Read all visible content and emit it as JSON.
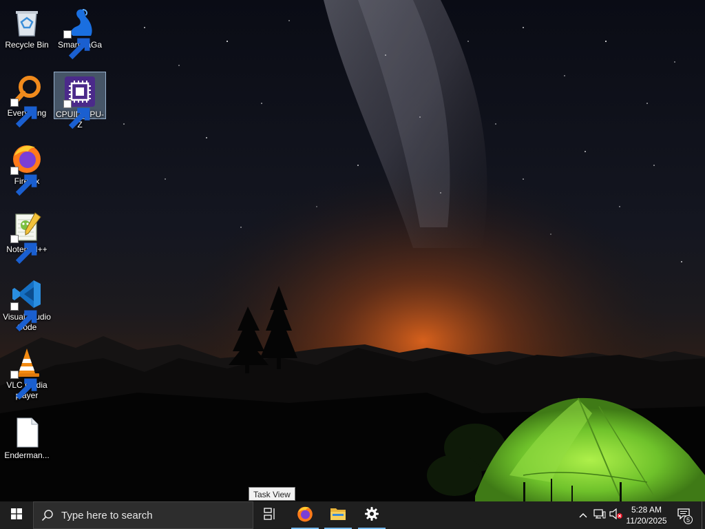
{
  "desktop": {
    "icons": [
      {
        "label": "Recycle Bin",
        "icon": "recycle-bin-icon",
        "shortcut": false,
        "selected": false
      },
      {
        "label": "SmartGaGa",
        "icon": "smartgaga-swan-icon",
        "shortcut": true,
        "selected": false
      },
      {
        "label": "Everything",
        "icon": "everything-magnifier-icon",
        "shortcut": true,
        "selected": false
      },
      {
        "label": "CPUID CPU-Z",
        "icon": "cpu-z-chip-icon",
        "shortcut": true,
        "selected": true
      },
      {
        "label": "Firefox",
        "icon": "firefox-icon",
        "shortcut": true,
        "selected": false
      },
      {
        "label": "Notepad++",
        "icon": "notepadpp-icon",
        "shortcut": true,
        "selected": false
      },
      {
        "label": "Visual Studio Code",
        "icon": "vscode-icon",
        "shortcut": true,
        "selected": false
      },
      {
        "label": "VLC media player",
        "icon": "vlc-cone-icon",
        "shortcut": true,
        "selected": false
      },
      {
        "label": "Enderman...",
        "icon": "blank-file-icon",
        "shortcut": false,
        "selected": false
      }
    ]
  },
  "tooltip": {
    "text": "Task View"
  },
  "taskbar": {
    "start": {
      "icon": "windows-logo-icon"
    },
    "search": {
      "placeholder": "Type here to search",
      "icon": "search-icon"
    },
    "task_view": {
      "icon": "task-view-icon"
    },
    "pinned_apps": [
      {
        "name": "Firefox",
        "icon": "firefox-icon",
        "running": true
      },
      {
        "name": "File Explorer",
        "icon": "folder-icon",
        "running": true
      },
      {
        "name": "Settings",
        "icon": "gear-icon",
        "running": true
      }
    ],
    "tray": {
      "overflow_icon": "chevron-up-icon",
      "network_icon": "network-icon",
      "volume_icon": "volume-muted-icon",
      "time": "5:28 AM",
      "date": "11/20/2025",
      "notification_icon": "action-center-icon",
      "notification_count": "5"
    }
  },
  "colors": {
    "taskbar_bg": "#1f1f1f",
    "accent": "#76b9ed",
    "tent": "#7bd23a",
    "horizon_glow": "#e0641c"
  }
}
